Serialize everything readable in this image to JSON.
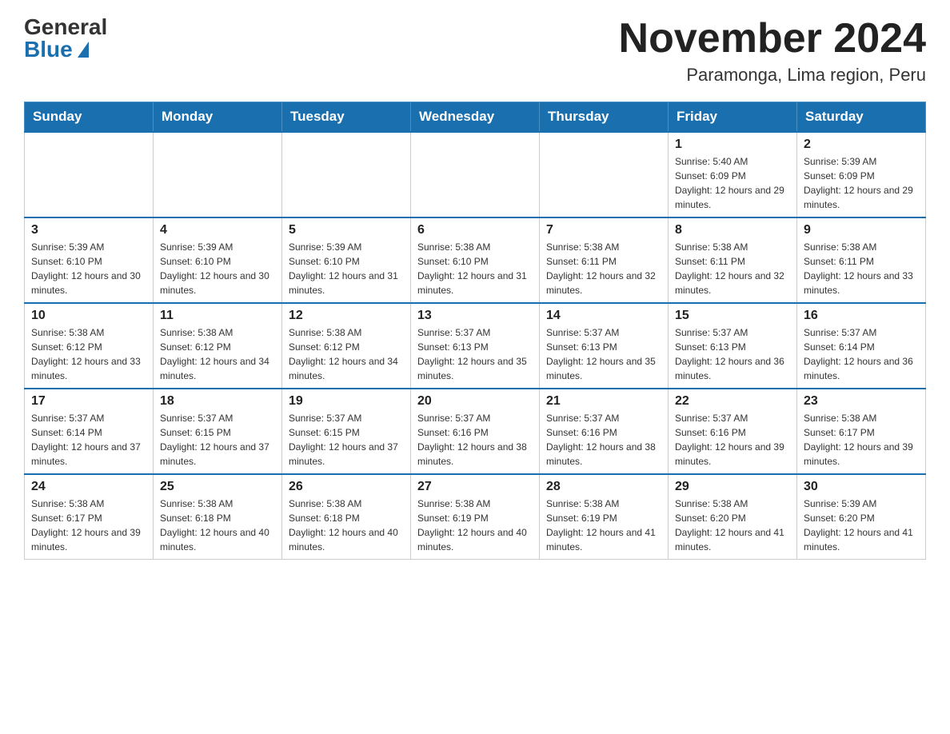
{
  "header": {
    "logo_general": "General",
    "logo_blue": "Blue",
    "month_title": "November 2024",
    "location": "Paramonga, Lima region, Peru"
  },
  "days_of_week": [
    "Sunday",
    "Monday",
    "Tuesday",
    "Wednesday",
    "Thursday",
    "Friday",
    "Saturday"
  ],
  "weeks": [
    [
      {
        "day": "",
        "info": ""
      },
      {
        "day": "",
        "info": ""
      },
      {
        "day": "",
        "info": ""
      },
      {
        "day": "",
        "info": ""
      },
      {
        "day": "",
        "info": ""
      },
      {
        "day": "1",
        "info": "Sunrise: 5:40 AM\nSunset: 6:09 PM\nDaylight: 12 hours and 29 minutes."
      },
      {
        "day": "2",
        "info": "Sunrise: 5:39 AM\nSunset: 6:09 PM\nDaylight: 12 hours and 29 minutes."
      }
    ],
    [
      {
        "day": "3",
        "info": "Sunrise: 5:39 AM\nSunset: 6:10 PM\nDaylight: 12 hours and 30 minutes."
      },
      {
        "day": "4",
        "info": "Sunrise: 5:39 AM\nSunset: 6:10 PM\nDaylight: 12 hours and 30 minutes."
      },
      {
        "day": "5",
        "info": "Sunrise: 5:39 AM\nSunset: 6:10 PM\nDaylight: 12 hours and 31 minutes."
      },
      {
        "day": "6",
        "info": "Sunrise: 5:38 AM\nSunset: 6:10 PM\nDaylight: 12 hours and 31 minutes."
      },
      {
        "day": "7",
        "info": "Sunrise: 5:38 AM\nSunset: 6:11 PM\nDaylight: 12 hours and 32 minutes."
      },
      {
        "day": "8",
        "info": "Sunrise: 5:38 AM\nSunset: 6:11 PM\nDaylight: 12 hours and 32 minutes."
      },
      {
        "day": "9",
        "info": "Sunrise: 5:38 AM\nSunset: 6:11 PM\nDaylight: 12 hours and 33 minutes."
      }
    ],
    [
      {
        "day": "10",
        "info": "Sunrise: 5:38 AM\nSunset: 6:12 PM\nDaylight: 12 hours and 33 minutes."
      },
      {
        "day": "11",
        "info": "Sunrise: 5:38 AM\nSunset: 6:12 PM\nDaylight: 12 hours and 34 minutes."
      },
      {
        "day": "12",
        "info": "Sunrise: 5:38 AM\nSunset: 6:12 PM\nDaylight: 12 hours and 34 minutes."
      },
      {
        "day": "13",
        "info": "Sunrise: 5:37 AM\nSunset: 6:13 PM\nDaylight: 12 hours and 35 minutes."
      },
      {
        "day": "14",
        "info": "Sunrise: 5:37 AM\nSunset: 6:13 PM\nDaylight: 12 hours and 35 minutes."
      },
      {
        "day": "15",
        "info": "Sunrise: 5:37 AM\nSunset: 6:13 PM\nDaylight: 12 hours and 36 minutes."
      },
      {
        "day": "16",
        "info": "Sunrise: 5:37 AM\nSunset: 6:14 PM\nDaylight: 12 hours and 36 minutes."
      }
    ],
    [
      {
        "day": "17",
        "info": "Sunrise: 5:37 AM\nSunset: 6:14 PM\nDaylight: 12 hours and 37 minutes."
      },
      {
        "day": "18",
        "info": "Sunrise: 5:37 AM\nSunset: 6:15 PM\nDaylight: 12 hours and 37 minutes."
      },
      {
        "day": "19",
        "info": "Sunrise: 5:37 AM\nSunset: 6:15 PM\nDaylight: 12 hours and 37 minutes."
      },
      {
        "day": "20",
        "info": "Sunrise: 5:37 AM\nSunset: 6:16 PM\nDaylight: 12 hours and 38 minutes."
      },
      {
        "day": "21",
        "info": "Sunrise: 5:37 AM\nSunset: 6:16 PM\nDaylight: 12 hours and 38 minutes."
      },
      {
        "day": "22",
        "info": "Sunrise: 5:37 AM\nSunset: 6:16 PM\nDaylight: 12 hours and 39 minutes."
      },
      {
        "day": "23",
        "info": "Sunrise: 5:38 AM\nSunset: 6:17 PM\nDaylight: 12 hours and 39 minutes."
      }
    ],
    [
      {
        "day": "24",
        "info": "Sunrise: 5:38 AM\nSunset: 6:17 PM\nDaylight: 12 hours and 39 minutes."
      },
      {
        "day": "25",
        "info": "Sunrise: 5:38 AM\nSunset: 6:18 PM\nDaylight: 12 hours and 40 minutes."
      },
      {
        "day": "26",
        "info": "Sunrise: 5:38 AM\nSunset: 6:18 PM\nDaylight: 12 hours and 40 minutes."
      },
      {
        "day": "27",
        "info": "Sunrise: 5:38 AM\nSunset: 6:19 PM\nDaylight: 12 hours and 40 minutes."
      },
      {
        "day": "28",
        "info": "Sunrise: 5:38 AM\nSunset: 6:19 PM\nDaylight: 12 hours and 41 minutes."
      },
      {
        "day": "29",
        "info": "Sunrise: 5:38 AM\nSunset: 6:20 PM\nDaylight: 12 hours and 41 minutes."
      },
      {
        "day": "30",
        "info": "Sunrise: 5:39 AM\nSunset: 6:20 PM\nDaylight: 12 hours and 41 minutes."
      }
    ]
  ]
}
